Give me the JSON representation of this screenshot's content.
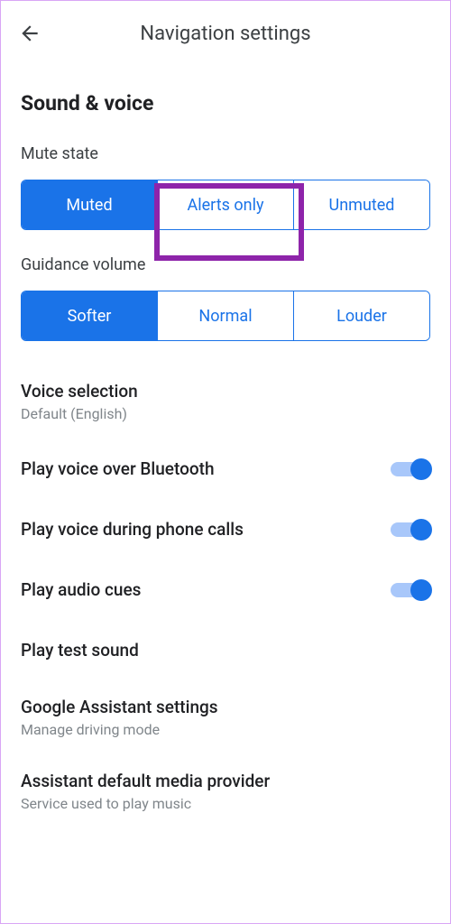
{
  "header": {
    "title": "Navigation settings"
  },
  "section": {
    "title": "Sound & voice"
  },
  "muteState": {
    "label": "Mute state",
    "options": [
      "Muted",
      "Alerts only",
      "Unmuted"
    ],
    "selected": 0
  },
  "guidanceVolume": {
    "label": "Guidance volume",
    "options": [
      "Softer",
      "Normal",
      "Louder"
    ],
    "selected": 0
  },
  "voiceSelection": {
    "title": "Voice selection",
    "subtitle": "Default (English)"
  },
  "toggles": {
    "bluetooth": {
      "label": "Play voice over Bluetooth",
      "on": true
    },
    "phoneCalls": {
      "label": "Play voice during phone calls",
      "on": true
    },
    "audioCues": {
      "label": "Play audio cues",
      "on": true
    }
  },
  "playTest": {
    "label": "Play test sound"
  },
  "assistant": {
    "title": "Google Assistant settings",
    "subtitle": "Manage driving mode"
  },
  "mediaProvider": {
    "title": "Assistant default media provider",
    "subtitle": "Service used to play music"
  }
}
